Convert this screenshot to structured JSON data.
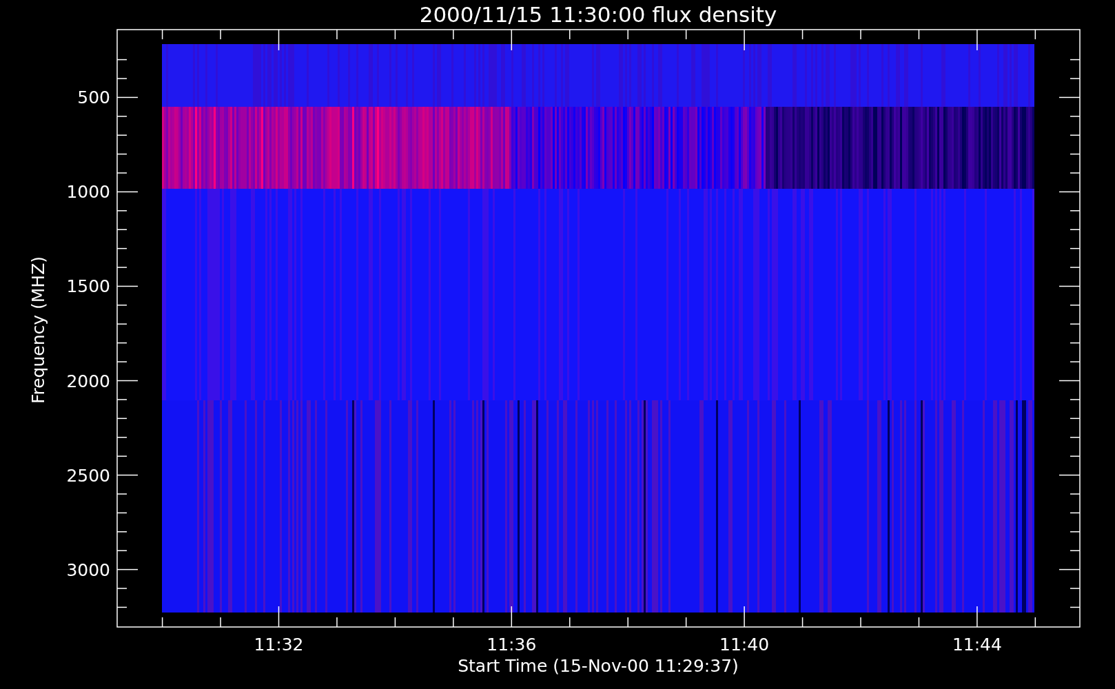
{
  "plot": {
    "title": "2000/11/15 11:30:00 flux density",
    "x_axis": {
      "label": "Start Time (15-Nov-00 11:29:37)",
      "ticks": [
        "11:32",
        "11:36",
        "11:40",
        "11:44"
      ]
    },
    "y_axis": {
      "label": "Frequency (MHZ)",
      "ticks": [
        "500",
        "1000",
        "1500",
        "2000",
        "2500",
        "3000"
      ]
    }
  }
}
